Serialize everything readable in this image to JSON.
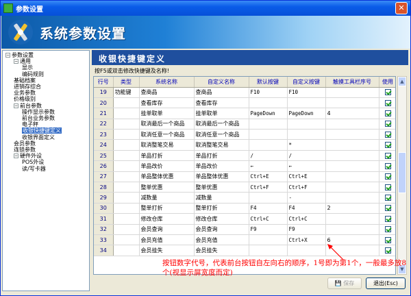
{
  "window": {
    "title": "参数设置"
  },
  "banner": {
    "title": "系统参数设置"
  },
  "tree": {
    "items": [
      {
        "label": "参数设置",
        "level": 0,
        "expander": "−"
      },
      {
        "label": "通用",
        "level": 1,
        "expander": "−"
      },
      {
        "label": "显示",
        "level": 2,
        "expander": ""
      },
      {
        "label": "编码规则",
        "level": 2,
        "expander": ""
      },
      {
        "label": "基础档案",
        "level": 1,
        "expander": ""
      },
      {
        "label": "进销存综合",
        "level": 1,
        "expander": ""
      },
      {
        "label": "业务参数",
        "level": 1,
        "expander": ""
      },
      {
        "label": "价格级别",
        "level": 1,
        "expander": ""
      },
      {
        "label": "前台参数",
        "level": 1,
        "expander": "−"
      },
      {
        "label": "操作显示参数",
        "level": 2,
        "expander": ""
      },
      {
        "label": "前台业务参数",
        "level": 2,
        "expander": ""
      },
      {
        "label": "电子秤",
        "level": 2,
        "expander": ""
      },
      {
        "label": "收银快捷键定义",
        "level": 2,
        "expander": "",
        "selected": true
      },
      {
        "label": "收银界面定义",
        "level": 2,
        "expander": ""
      },
      {
        "label": "会员参数",
        "level": 1,
        "expander": ""
      },
      {
        "label": "连锁参数",
        "level": 1,
        "expander": ""
      },
      {
        "label": "硬件外设",
        "level": 1,
        "expander": "−"
      },
      {
        "label": "POS外设",
        "level": 2,
        "expander": ""
      },
      {
        "label": "读/写卡器",
        "level": 2,
        "expander": ""
      }
    ]
  },
  "content": {
    "title": "收银快捷键定义",
    "hint": "按F5或双击修改快捷键及名称!"
  },
  "grid": {
    "columns": [
      "行号",
      "类型",
      "系统名称",
      "自定义名称",
      "默认按键",
      "自定义按键",
      "触摸工具栏序号",
      "使用"
    ],
    "rows": [
      {
        "no": "19",
        "type": "功能键",
        "sys": "查商品",
        "custom": "查商品",
        "defkey": "F10",
        "custkey": "F10",
        "touch": "",
        "use": true
      },
      {
        "no": "20",
        "type": "",
        "sys": "查看库存",
        "custom": "查看库存",
        "defkey": "",
        "custkey": "",
        "touch": "",
        "use": true
      },
      {
        "no": "21",
        "type": "",
        "sys": "挂单取单",
        "custom": "挂单取单",
        "defkey": "PageDown",
        "custkey": "PageDown",
        "touch": "4",
        "use": true
      },
      {
        "no": "22",
        "type": "",
        "sys": "取消最后一个商品",
        "custom": "取消最后一个商品",
        "defkey": "",
        "custkey": "",
        "touch": "",
        "use": true
      },
      {
        "no": "23",
        "type": "",
        "sys": "取消任意一个商品",
        "custom": "取消任意一个商品",
        "defkey": "",
        "custkey": "",
        "touch": "",
        "use": true
      },
      {
        "no": "24",
        "type": "",
        "sys": "取消整笔交易",
        "custom": "取消整笔交易",
        "defkey": "",
        "custkey": "*",
        "touch": "",
        "use": true
      },
      {
        "no": "25",
        "type": "",
        "sys": "单品打折",
        "custom": "单品打折",
        "defkey": "/",
        "custkey": "/",
        "touch": "",
        "use": true
      },
      {
        "no": "26",
        "type": "",
        "sys": "单品改价",
        "custom": "单品改价",
        "defkey": "←",
        "custkey": "←",
        "touch": "",
        "use": true
      },
      {
        "no": "27",
        "type": "",
        "sys": "单品整体优惠",
        "custom": "单品整体优惠",
        "defkey": "Ctrl+E",
        "custkey": "Ctrl+E",
        "touch": "",
        "use": true
      },
      {
        "no": "28",
        "type": "",
        "sys": "整单优惠",
        "custom": "整单优惠",
        "defkey": "Ctrl+F",
        "custkey": "Ctrl+F",
        "touch": "",
        "use": true
      },
      {
        "no": "29",
        "type": "",
        "sys": "减数量",
        "custom": "减数量",
        "defkey": "",
        "custkey": "-",
        "touch": "",
        "use": true
      },
      {
        "no": "30",
        "type": "",
        "sys": "整单打折",
        "custom": "整单打折",
        "defkey": "F4",
        "custkey": "F4",
        "touch": "2",
        "use": true
      },
      {
        "no": "31",
        "type": "",
        "sys": "修改仓库",
        "custom": "修改仓库",
        "defkey": "Ctrl+C",
        "custkey": "Ctrl+C",
        "touch": "",
        "use": true
      },
      {
        "no": "32",
        "type": "",
        "sys": "会员查询",
        "custom": "会员查询",
        "defkey": "F9",
        "custkey": "F9",
        "touch": "",
        "use": true
      },
      {
        "no": "33",
        "type": "",
        "sys": "会员充值",
        "custom": "会员充值",
        "defkey": "",
        "custkey": "Ctrl+X",
        "touch": "6",
        "use": true
      },
      {
        "no": "34",
        "type": "",
        "sys": "会员挂失",
        "custom": "会员挂失",
        "defkey": "",
        "custkey": "",
        "touch": "",
        "use": true
      }
    ]
  },
  "buttons": {
    "save": "保存",
    "exit": "退出(Esc)"
  },
  "annotation": "按钮数字代号，代表前台按钮自左向右的顺序，1号即为第1个，一般最多放8个(视显示屏宽度而定)",
  "colors": {
    "annotation": "#ff0000",
    "header_band": "#1f4f9e",
    "checkbox_check": "#21a121"
  }
}
